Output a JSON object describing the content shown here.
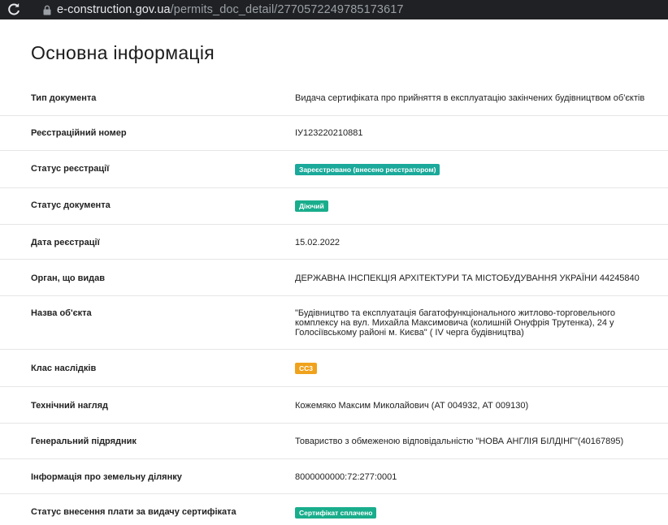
{
  "browser": {
    "url_host": "e-construction.gov.ua",
    "url_path": "/permits_doc_detail/2770572249785173617"
  },
  "page": {
    "title": "Основна інформація"
  },
  "colors": {
    "badge_teal": "#1aa99a",
    "badge_green": "#19ad8c",
    "badge_amber": "#f0a21c"
  },
  "rows": [
    {
      "label": "Тип документа",
      "value": "Видача сертифіката про прийняття в експлуатацію закінчених будівництвом об'єктів"
    },
    {
      "label": "Реєстраційний номер",
      "value": "ІУ123220210881"
    },
    {
      "label": "Статус реєстрації",
      "badge": "Зареєстровано (внесено реєстратором)"
    },
    {
      "label": "Статус документа",
      "badge": "Діючий"
    },
    {
      "label": "Дата реєстрації",
      "value": "15.02.2022"
    },
    {
      "label": "Орган, що видав",
      "value": "ДЕРЖАВНА ІНСПЕКЦІЯ АРХІТЕКТУРИ ТА МІСТОБУДУВАННЯ УКРАЇНИ 44245840"
    },
    {
      "label": "Назва об'єкта",
      "value": "\"Будівництво та експлуатація багатофункціонального житлово-торговельного комплексу на вул. Михайла Максимовича (колишній Онуфрія Трутенка), 24 у Голосіївському районі м. Києва\" ( IV черга будівництва)"
    },
    {
      "label": "Клас наслідків",
      "badge": "СС3"
    },
    {
      "label": "Технічний нагляд",
      "value": "Кожемяко Максим Миколайович (АТ 004932, АТ 009130)"
    },
    {
      "label": "Генеральний підрядник",
      "value": "Товариство з обмеженою відповідальністю \"НОВА АНГЛІЯ БІЛДІНГ\"(40167895)"
    },
    {
      "label": "Інформація про земельну ділянку",
      "value": "8000000000:72:277:0001"
    },
    {
      "label": "Статус внесення плати за видачу сертифіката",
      "badge": "Сертифікат сплачено"
    }
  ]
}
